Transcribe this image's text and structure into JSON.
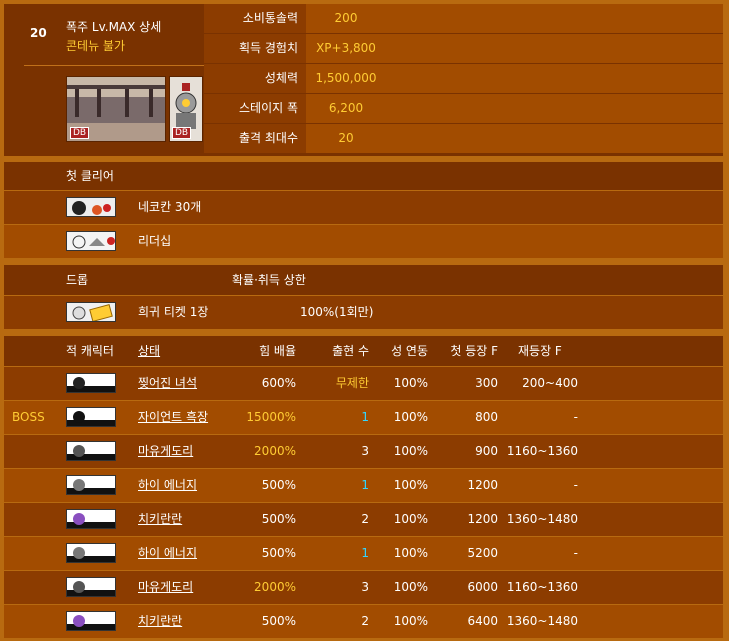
{
  "stage": {
    "number": "20",
    "title": "폭주 Lv.MAX 상세",
    "subtitle": "콘테뉴 불가"
  },
  "stats": [
    {
      "label": "소비통솔력",
      "value": "200"
    },
    {
      "label": "획득 경험치",
      "value": "XP+3,800"
    },
    {
      "label": "성체력",
      "value": "1,500,000"
    },
    {
      "label": "스테이지 폭",
      "value": "6,200"
    },
    {
      "label": "출격 최대수",
      "value": "20"
    }
  ],
  "badges": {
    "db1": "DB",
    "db2": "DB"
  },
  "first_clear": {
    "header": "첫 클리어",
    "items": [
      {
        "label": "네코칸 30개"
      },
      {
        "label": "리더십"
      }
    ]
  },
  "drops": {
    "header_drop": "드롭",
    "header_rate": "확률·취득 상한",
    "items": [
      {
        "label": "희귀 티켓 1장",
        "rate": "100%(1회만)"
      }
    ]
  },
  "enemies": {
    "headers": {
      "char": "적 캐릭터",
      "state": "상태",
      "power": "힘 배율",
      "count": "출현 수",
      "cont": "성 연동",
      "first": "첫 등장 F",
      "re": "재등장 F"
    },
    "rows": [
      {
        "tag": "",
        "name": "찢어진 녀석",
        "power": "600%",
        "count": "무제한",
        "cont": "100%",
        "first": "300",
        "re": "200~400",
        "power_gold": false,
        "count_style": "gold"
      },
      {
        "tag": "BOSS",
        "name": "자이언트 흑장",
        "power": "15000%",
        "count": "1",
        "cont": "100%",
        "first": "800",
        "re": "-",
        "power_gold": true,
        "count_style": "cyan"
      },
      {
        "tag": "",
        "name": "마유게도리",
        "power": "2000%",
        "count": "3",
        "cont": "100%",
        "first": "900",
        "re": "1160~1360",
        "power_gold": true,
        "count_style": "white"
      },
      {
        "tag": "",
        "name": "하이 에너지",
        "power": "500%",
        "count": "1",
        "cont": "100%",
        "first": "1200",
        "re": "-",
        "power_gold": false,
        "count_style": "cyan"
      },
      {
        "tag": "",
        "name": "치키란란",
        "power": "500%",
        "count": "2",
        "cont": "100%",
        "first": "1200",
        "re": "1360~1480",
        "power_gold": false,
        "count_style": "white"
      },
      {
        "tag": "",
        "name": "하이 에너지",
        "power": "500%",
        "count": "1",
        "cont": "100%",
        "first": "5200",
        "re": "-",
        "power_gold": false,
        "count_style": "cyan"
      },
      {
        "tag": "",
        "name": "마유게도리",
        "power": "2000%",
        "count": "3",
        "cont": "100%",
        "first": "6000",
        "re": "1160~1360",
        "power_gold": true,
        "count_style": "white"
      },
      {
        "tag": "",
        "name": "치키란란",
        "power": "500%",
        "count": "2",
        "cont": "100%",
        "first": "6400",
        "re": "1360~1480",
        "power_gold": false,
        "count_style": "white"
      }
    ]
  }
}
